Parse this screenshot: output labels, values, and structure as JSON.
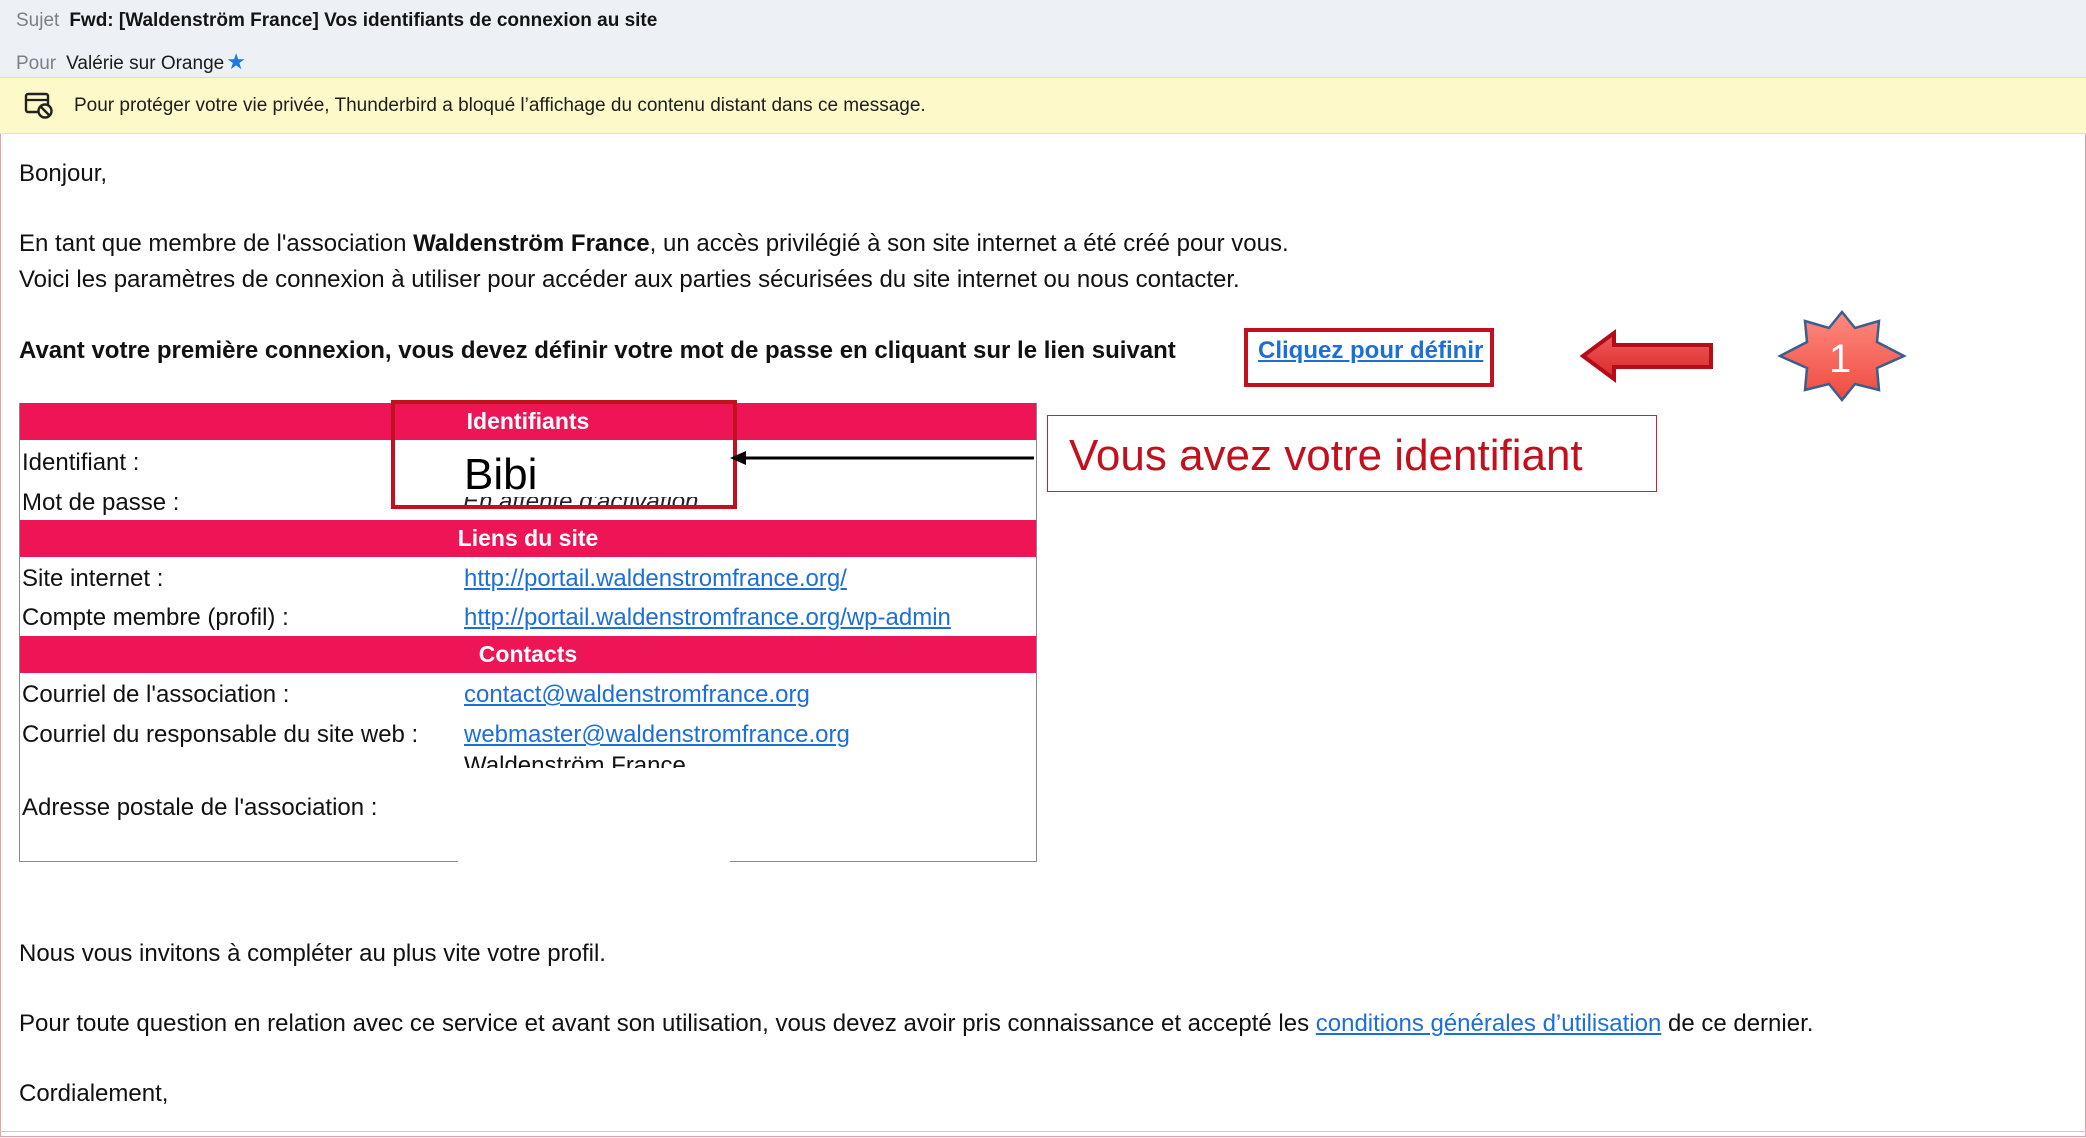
{
  "header": {
    "subject_label": "Sujet",
    "subject": "Fwd: [Waldenström France] Vos identifiants de connexion au site",
    "to_label": "Pour",
    "to": "Valérie sur Orange"
  },
  "banner": {
    "text": "Pour protéger votre vie privée, Thunderbird a bloqué l’affichage du contenu distant dans ce message."
  },
  "message": {
    "greeting": "Bonjour,",
    "intro_prefix": "En tant que membre de l'association ",
    "intro_org": "Waldenström France",
    "intro_suffix": ", un accès privilégié à son site internet a été créé pour vous.",
    "intro_line2": "Voici les paramètres de connexion à utiliser pour accéder aux parties sécurisées du site internet ou nous contacter.",
    "first_login": "Avant votre première connexion, vous devez définir votre mot de passe en cliquant sur le lien suivant",
    "first_login_link": "Cliquez pour définir",
    "invite": "Nous vous invitons à compléter au plus vite votre profil.",
    "question_prefix": "Pour toute question en relation avec ce service et avant son utilisation, vous devez avoir pris connaissance et accepté les ",
    "question_link": "conditions générales d’utilisation",
    "question_suffix": " de ce dernier.",
    "closing": "Cordialement,"
  },
  "table": {
    "sections": {
      "identifiants": "Identifiants",
      "liens": "Liens du site",
      "contacts": "Contacts"
    },
    "rows": {
      "identifiant_label": "Identifiant :",
      "identifiant_value": "Bibi",
      "password_label": "Mot de passe :",
      "password_value": "En attente d'activation",
      "site_label": "Site internet :",
      "site_value": "http://portail.waldenstromfrance.org/",
      "account_label": "Compte membre (profil) :",
      "account_value": "http://portail.waldenstromfrance.org/wp-admin",
      "assoc_email_label": "Courriel de l'association :",
      "assoc_email_value": "contact@waldenstromfrance.org",
      "webmaster_label": "Courriel du responsable du site web :",
      "webmaster_value": "webmaster@waldenstromfrance.org",
      "postal_partial": "Waldenström France",
      "postal_label": "Adresse postale de l'association :"
    }
  },
  "annotations": {
    "callout_text": "Vous avez votre identifiant",
    "step_number": "1",
    "accent_color": "#c3101e"
  }
}
